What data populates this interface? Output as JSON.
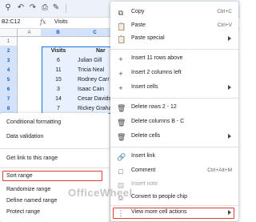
{
  "formula_bar": {
    "name_box": "B2:C12",
    "fx": "fx",
    "value": "Visits"
  },
  "columns": [
    "A",
    "B",
    "C"
  ],
  "rows": [
    "1",
    "2",
    "3",
    "4",
    "5",
    "6",
    "7",
    "8"
  ],
  "table": {
    "header_visits": "Visits",
    "header_name": "Nar",
    "visits": [
      "6",
      "11",
      "15",
      "3",
      "14",
      "7"
    ],
    "names": [
      "Julian Gill",
      "Tricia Neal",
      "Rodney Carr",
      "Isaac Cain",
      "Cesar Davids",
      "Rickey Graha"
    ]
  },
  "left_menu": {
    "items": [
      "Conditional formatting",
      "Data validation",
      "Get link to this range",
      "Sort range",
      "Randomize range",
      "Define named range",
      "Protect range"
    ]
  },
  "right_menu": {
    "copy": "Copy",
    "copy_shortcut": "Ctrl+C",
    "paste": "Paste",
    "paste_shortcut": "Ctrl+V",
    "paste_special": "Paste special",
    "insert_rows": "Insert 11 rows above",
    "insert_columns": "Insert 2 columns left",
    "insert_cells": "Insert cells",
    "delete_rows": "Delete rows 2 - 12",
    "delete_columns": "Delete columns B - C",
    "delete_cells": "Delete cells",
    "insert_link": "Insert link",
    "comment": "Comment",
    "comment_shortcut": "Ctrl+Alt+M",
    "insert_note": "Insert note",
    "convert_chip": "Convert to people chip",
    "view_more": "View more cell actions"
  },
  "watermark": "OfficeWheel"
}
